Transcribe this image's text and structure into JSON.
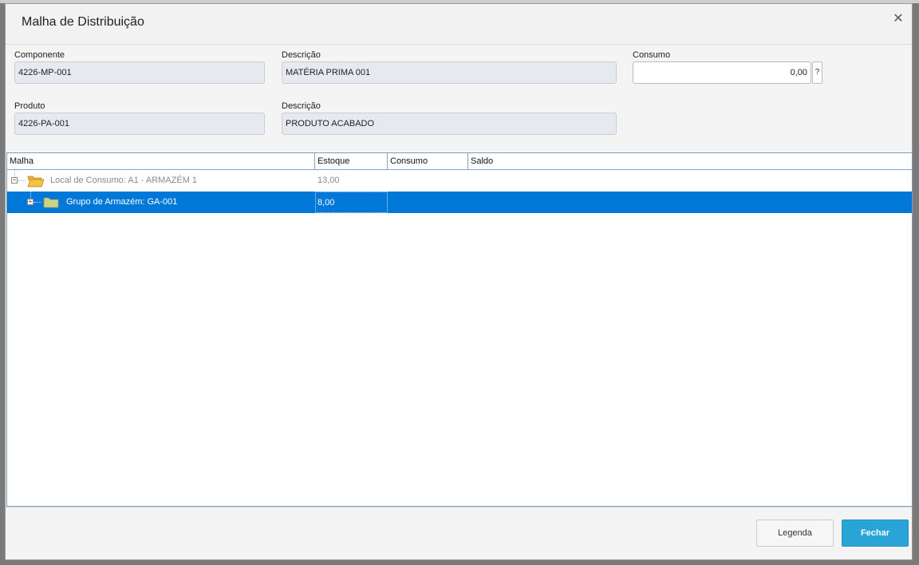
{
  "dialog": {
    "title": "Malha de Distribuição",
    "close_glyph": "✕"
  },
  "fields": {
    "componente": {
      "label": "Componente",
      "value": "4226-MP-001"
    },
    "descricao_componente": {
      "label": "Descrição",
      "value": "MATÉRIA PRIMA 001"
    },
    "consumo": {
      "label": "Consumo",
      "value": "0,00",
      "help": "?"
    },
    "produto": {
      "label": "Produto",
      "value": "4226-PA-001"
    },
    "descricao_produto": {
      "label": "Descrição",
      "value": "PRODUTO ACABADO"
    }
  },
  "grid": {
    "columns": [
      "Malha",
      "Estoque",
      "Consumo",
      "Saldo"
    ],
    "rows": [
      {
        "label": "Local de Consumo: A1 - ARMAZÉM 1",
        "estoque": "13,00",
        "consumo": "",
        "saldo": "",
        "icon": "open-folder-icon",
        "expander": "−",
        "selected": false
      },
      {
        "label": "Grupo de Armazém: GA-001",
        "estoque": "8,00",
        "consumo": "",
        "saldo": "",
        "icon": "folder-icon",
        "expander": "+",
        "selected": true
      }
    ]
  },
  "buttons": {
    "legenda": "Legenda",
    "fechar": "Fechar"
  },
  "colors": {
    "selection": "#0078d7",
    "primary_button": "#2aa3d6",
    "folder_open": "#f5c342",
    "folder_closed": "#c8d48c"
  }
}
